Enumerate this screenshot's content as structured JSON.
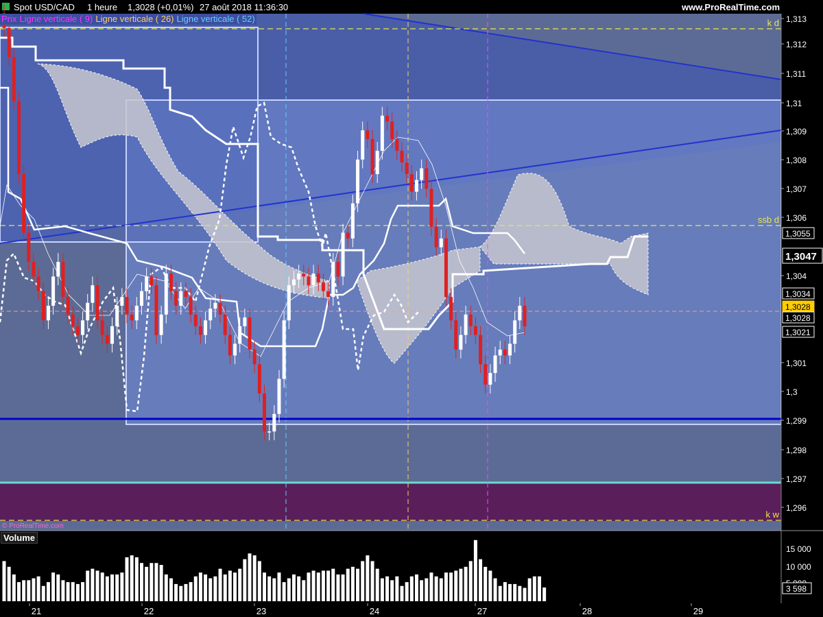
{
  "header": {
    "instrument": "Spot USD/CAD",
    "timeframe": "1 heure",
    "price_change": "1,3028 (+0,01%)",
    "datetime": "27 août 2018 11:36:30",
    "site": "www.ProRealTime.com"
  },
  "legend": [
    {
      "label": "Prix",
      "color": "#ff33ff"
    },
    {
      "label": "Ligne verticale ( 9)",
      "color": "#ff33ff"
    },
    {
      "label": "Ligne verticale ( 26)",
      "color": "#ffcc66"
    },
    {
      "label": "Ligne verticale ( 52)",
      "color": "#66ccff"
    }
  ],
  "watermark": "© ProRealTime.com",
  "volume_panel": {
    "title": "Volume"
  },
  "colors": {
    "background": "#5c6b95",
    "upper_shade": "#4a5ea8",
    "box_fill": "#6b82c8",
    "lower_band": "#5a1f5a",
    "kijun": "#ffffff",
    "cloud": "#c7c7cf",
    "trendline": "#2233cc",
    "level_line": "#e8e84a",
    "down_candle": "#e02020",
    "up_candle": "#ffffff",
    "support": "#0000cc",
    "teal_line": "#66ddcc"
  },
  "chart_data": [
    {
      "type": "candlestick",
      "title": "Spot USD/CAD",
      "x_tick_labels": [
        "21",
        "22",
        "23",
        "24",
        "27",
        "28",
        "29"
      ],
      "y_tick_labels": [
        "1,296",
        "1,297",
        "1,298",
        "1,299",
        "1,3",
        "1,301",
        "1,304",
        "1,306",
        "1,307",
        "1,308",
        "1,309",
        "1,31",
        "1,311",
        "1,312",
        "1,313"
      ],
      "ylim": [
        1.2955,
        1.3133
      ],
      "price_flags": [
        {
          "label": "1,3055",
          "value": 1.3055
        },
        {
          "label": "1,3047",
          "value": 1.3047,
          "emphasis": true
        },
        {
          "label": "1,3034",
          "value": 1.3034
        },
        {
          "label": "1,3028",
          "value": 1.3028,
          "highlight": true
        },
        {
          "label": "1,3028",
          "value": 1.30175
        },
        {
          "label": "1,3021",
          "value": 1.3021
        }
      ],
      "level_lines": [
        {
          "label": "k d",
          "value": 1.3126
        },
        {
          "label": "ssb d",
          "value": 1.3058
        },
        {
          "label": "k w",
          "value": 1.2955
        }
      ],
      "support_value": 1.2991,
      "vertical_lines": [
        {
          "name": "Ligne verticale ( 9)",
          "date": "27"
        },
        {
          "name": "Ligne verticale ( 26)",
          "date": "24"
        },
        {
          "name": "Ligne verticale ( 52)",
          "date": "23"
        }
      ],
      "closes": [
        1.313,
        1.312,
        1.3105,
        1.308,
        1.306,
        1.305,
        1.3045,
        1.304,
        1.303,
        1.3035,
        1.3045,
        1.305,
        1.3038,
        1.3032,
        1.3028,
        1.3025,
        1.303,
        1.3036,
        1.3042,
        1.303,
        1.3025,
        1.3022,
        1.3028,
        1.3035,
        1.3038,
        1.3032,
        1.303,
        1.3035,
        1.304,
        1.3045,
        1.3042,
        1.3025,
        1.3032,
        1.3046,
        1.304,
        1.3035,
        1.304,
        1.3038,
        1.3032,
        1.3028,
        1.3025,
        1.303,
        1.3034,
        1.3036,
        1.3032,
        1.3025,
        1.3018,
        1.3022,
        1.3028,
        1.3031,
        1.302,
        1.3015,
        1.3005,
        1.2992,
        1.2992,
        1.2998,
        1.301,
        1.303,
        1.3042,
        1.3044,
        1.3046,
        1.3045,
        1.3042,
        1.3046,
        1.3043,
        1.304,
        1.3038,
        1.305,
        1.3045,
        1.306,
        1.3058,
        1.307,
        1.3085,
        1.3095,
        1.3092,
        1.308,
        1.3088,
        1.31,
        1.3098,
        1.3092,
        1.3088,
        1.3084,
        1.308,
        1.3074,
        1.3078,
        1.3082,
        1.3075,
        1.3062,
        1.3055,
        1.3058,
        1.3038,
        1.303,
        1.302,
        1.3025,
        1.3032,
        1.3028,
        1.3025,
        1.3015,
        1.3008,
        1.3012,
        1.3018,
        1.302,
        1.3018,
        1.3022,
        1.303,
        1.3035,
        1.3028
      ],
      "series": [
        {
          "name": "Volume",
          "type": "bar",
          "y_tick_labels": [
            "15 000",
            "10 000",
            "5 000",
            "3 598"
          ],
          "last": 3598,
          "values": [
            10500,
            9000,
            7000,
            5000,
            5500,
            5500,
            6000,
            6500,
            4000,
            5000,
            7500,
            7000,
            5500,
            5000,
            5000,
            4500,
            5000,
            8000,
            8500,
            8000,
            7500,
            6500,
            7000,
            7000,
            7500,
            11500,
            12000,
            11500,
            10000,
            9000,
            10000,
            10000,
            9500,
            7000,
            6000,
            4500,
            4000,
            4500,
            5000,
            6500,
            7500,
            7000,
            6000,
            6500,
            8500,
            7000,
            8000,
            7500,
            8500,
            11000,
            12500,
            12000,
            10500,
            7500,
            6500,
            6000,
            7500,
            5000,
            6000,
            7000,
            6500,
            5500,
            7500,
            8000,
            7500,
            8000,
            8000,
            8500,
            7000,
            7000,
            8500,
            9000,
            8500,
            10500,
            12000,
            10500,
            8500,
            6000,
            6500,
            5500,
            6500,
            4000,
            5000,
            6500,
            7000,
            5500,
            6000,
            7500,
            6500,
            6000,
            7500,
            7500,
            8000,
            8500,
            9000,
            10500,
            16000,
            11000,
            9000,
            8000,
            6000,
            4000,
            5000,
            4500,
            4500,
            4000,
            3500,
            6000,
            6500,
            6500,
            3598
          ]
        }
      ]
    }
  ]
}
